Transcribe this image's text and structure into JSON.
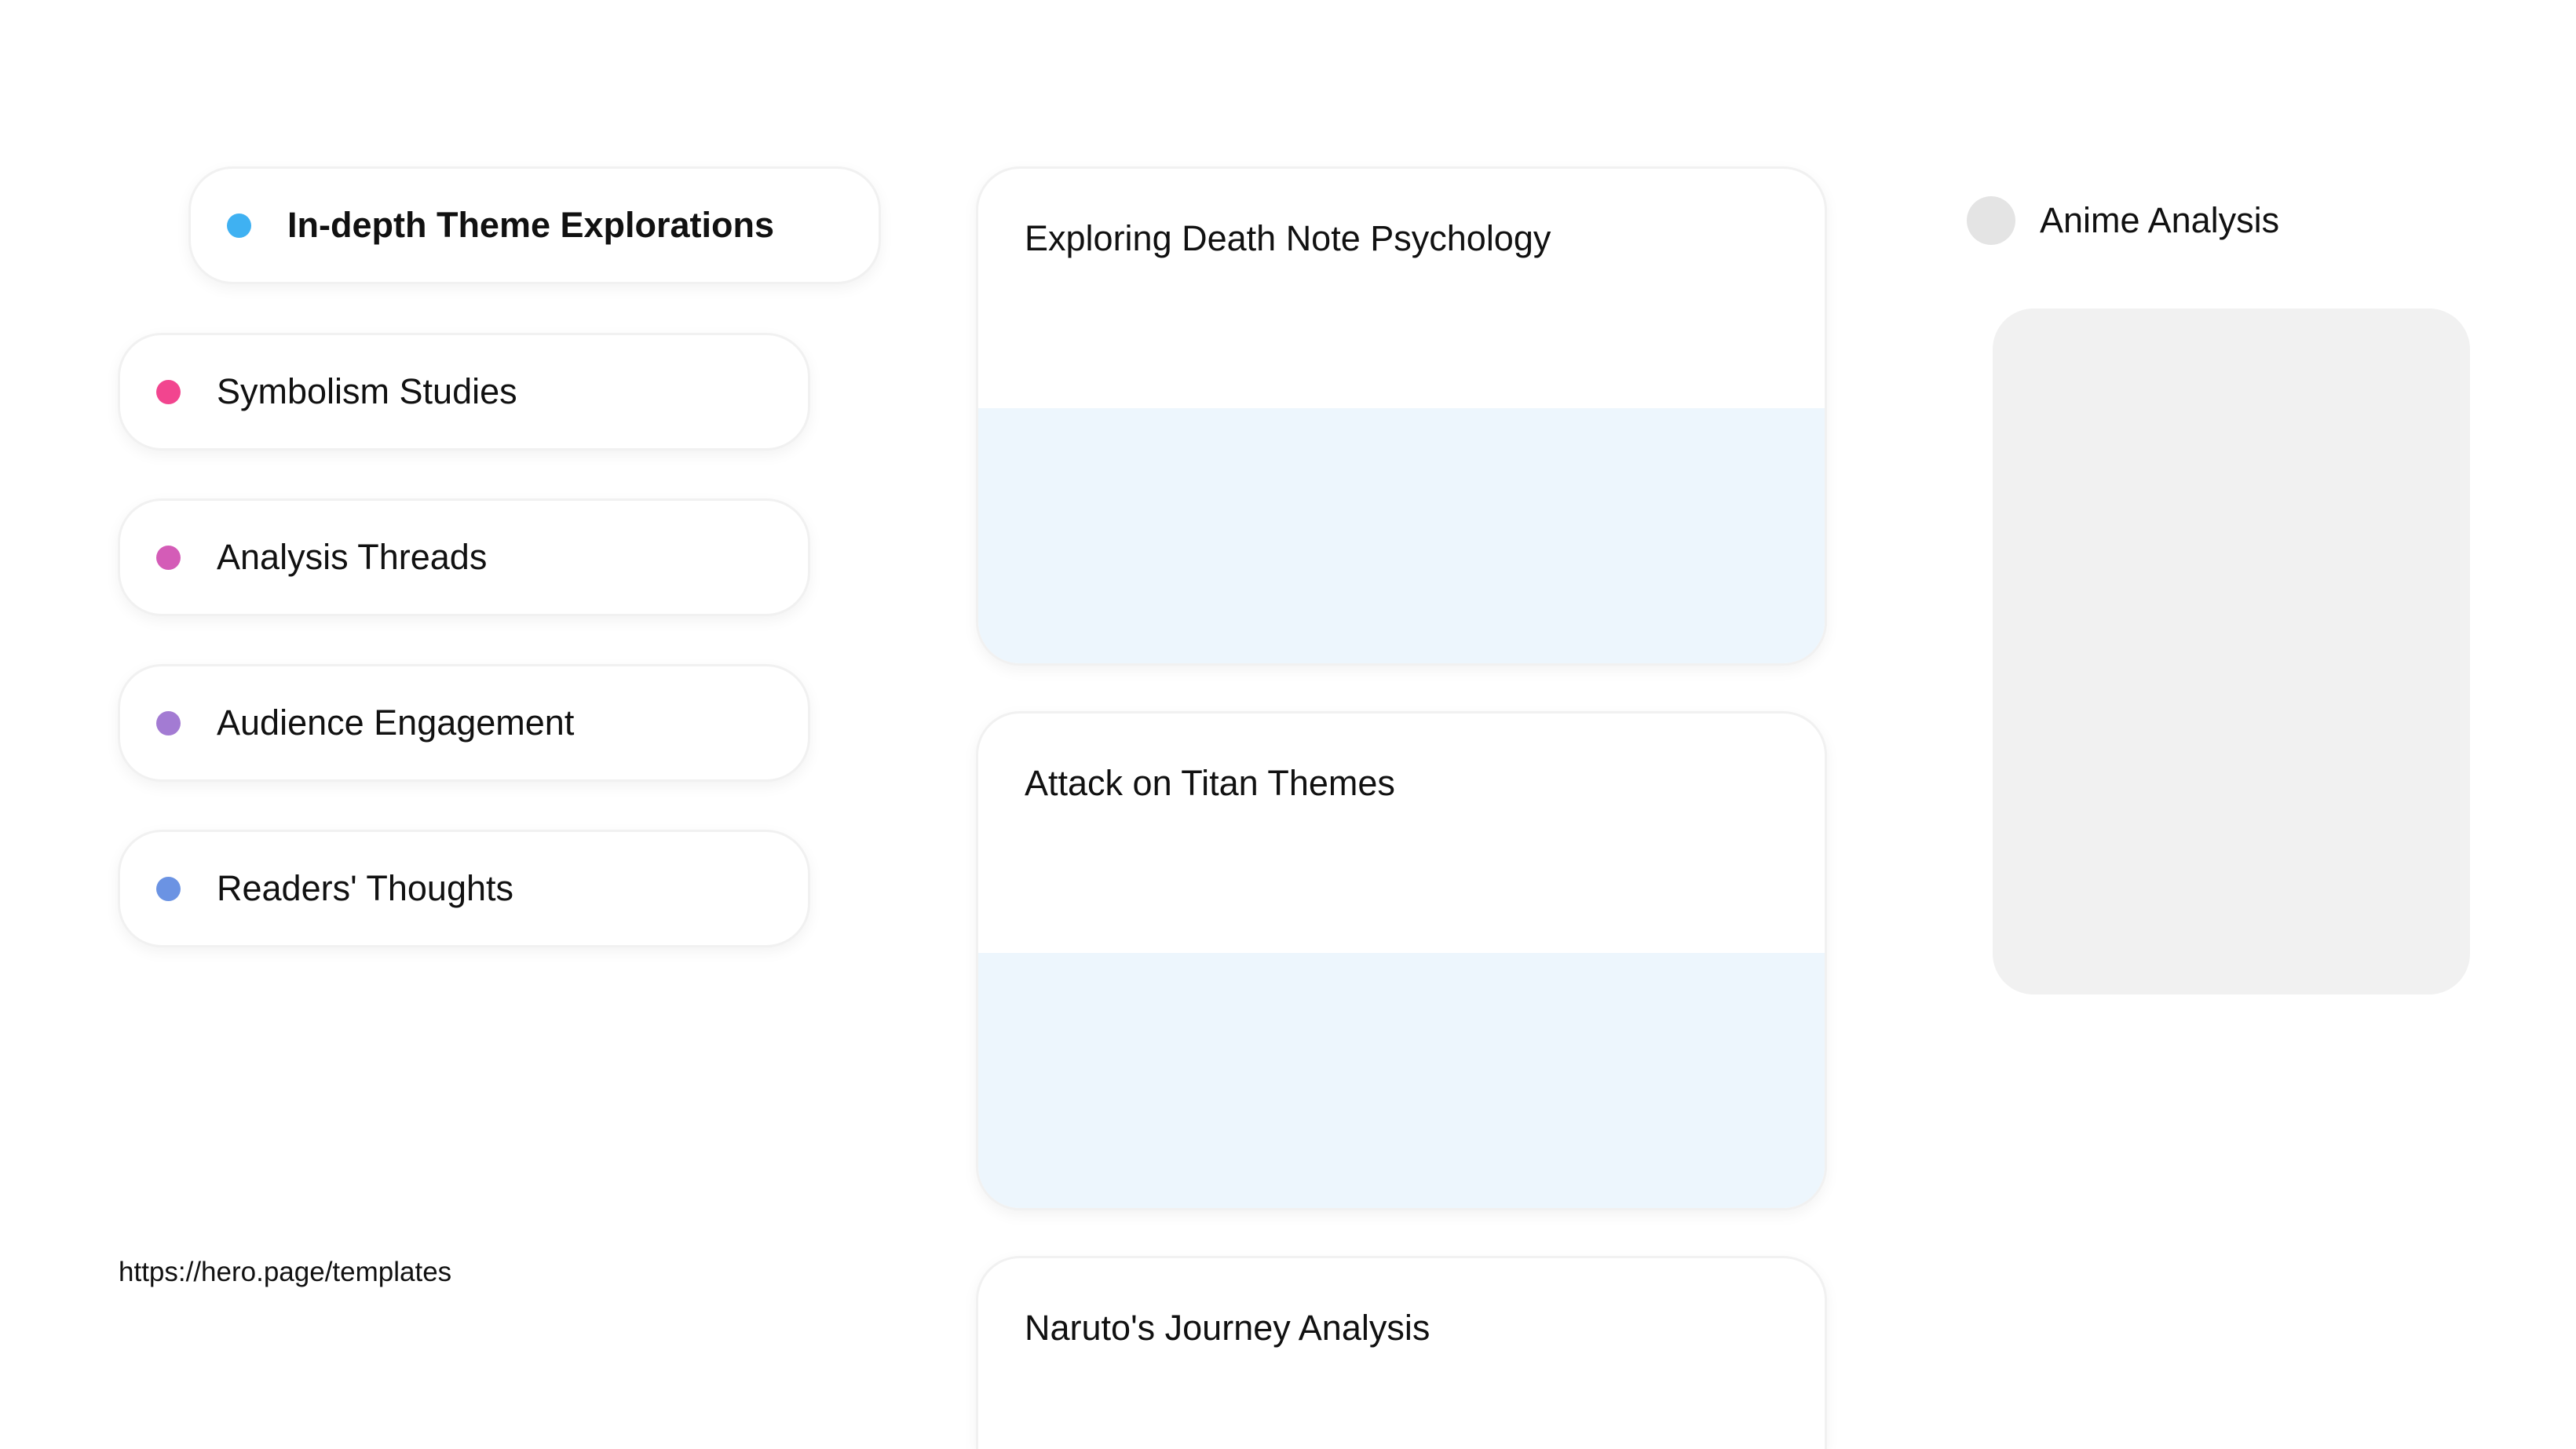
{
  "nav": {
    "items": [
      {
        "label": "In-depth Theme Explorations",
        "color": "#3fb1f2",
        "active": true
      },
      {
        "label": "Symbolism Studies",
        "color": "#f2458f",
        "active": false
      },
      {
        "label": "Analysis Threads",
        "color": "#d45cb7",
        "active": false
      },
      {
        "label": "Audience Engagement",
        "color": "#a37bd3",
        "active": false
      },
      {
        "label": "Readers' Thoughts",
        "color": "#6b93e3",
        "active": false
      }
    ]
  },
  "footer": {
    "url": "https://hero.page/templates"
  },
  "cards": [
    {
      "title": "Exploring Death Note Psychology"
    },
    {
      "title": "Attack on Titan Themes"
    },
    {
      "title": "Naruto's Journey Analysis"
    }
  ],
  "profile": {
    "label": "Anime Analysis"
  }
}
